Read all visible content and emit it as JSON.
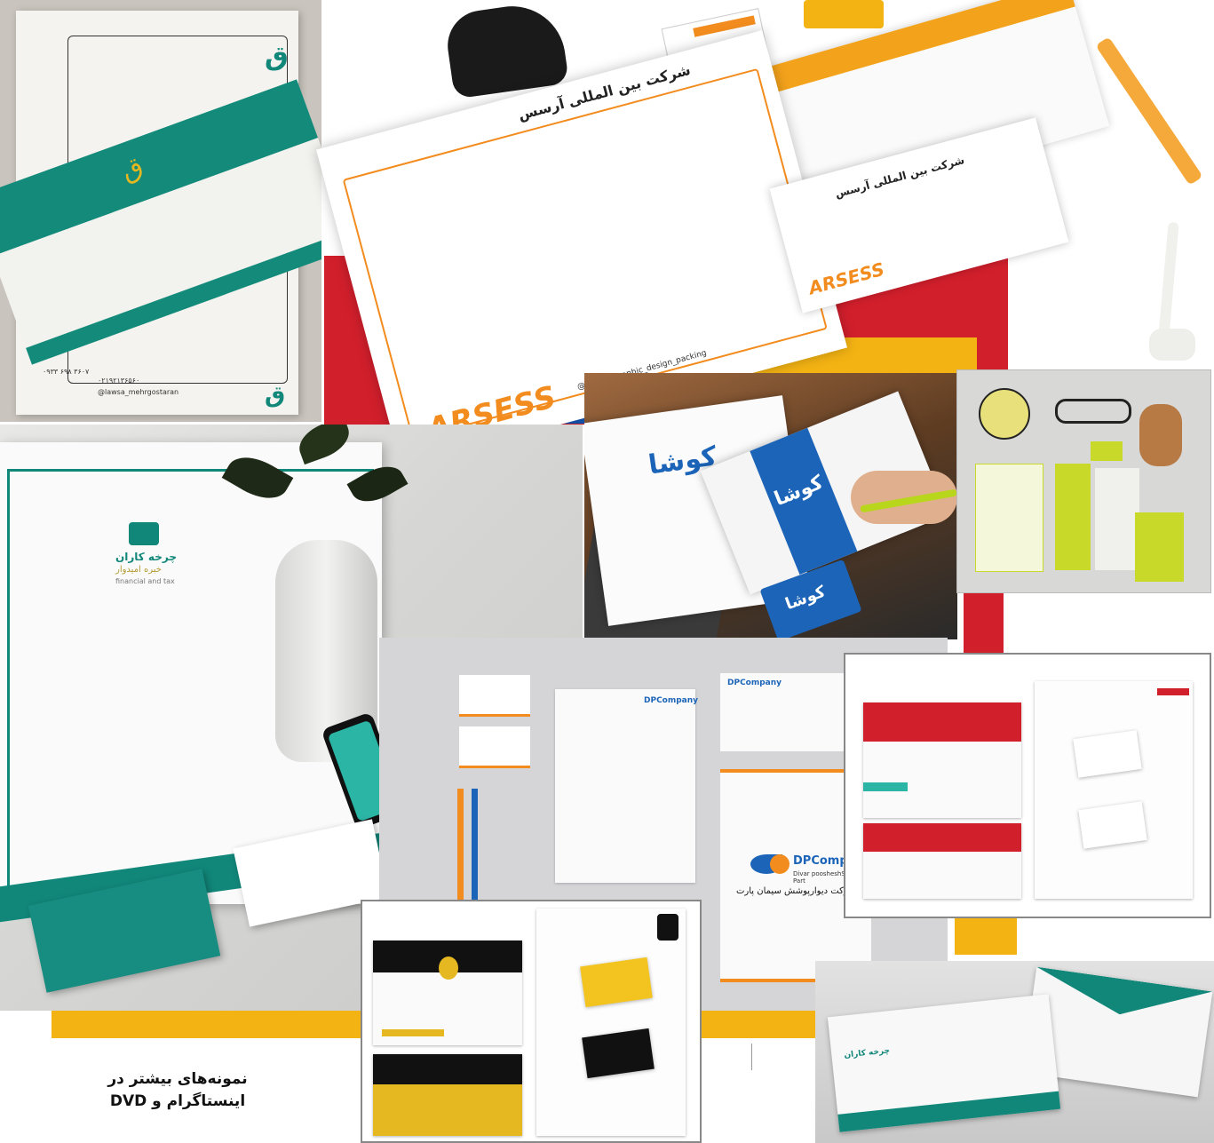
{
  "caption": {
    "line1": "نمونه‌های بیشتر در",
    "line2": "اینستاگرام و DVD"
  },
  "brands": {
    "arsess": "ARSESS",
    "arsess_title": "شرکت بین المللی آرسس",
    "arsess_handle": "@arsess_graphic_design_packing",
    "koosha": "کوشا",
    "dp_company": "DPCompany",
    "dp_sub": "Divar poosheshSiman Part",
    "dp_fa": "شرکت دیوارپوشش سیمان پارت",
    "charkhe": "چرخه کاران",
    "charkhe_fa": "خبره امیدوار",
    "charkhe_en": "financial and tax",
    "mehr_handle": "@lawsa_mehrgostaran",
    "mehr_phone": "۰۹۳۳ ۶۹۸ ۳۶۰۷",
    "mehr_phone2": "۰۲۱۹۲۱۳۶۵۶۰"
  },
  "colors": {
    "red": "#d21f2c",
    "yellow": "#f3b313",
    "blue": "#1457b5",
    "orange": "#f28c1e",
    "teal": "#11877a",
    "koosha_blue": "#1c64b8",
    "gold": "#e5b821"
  }
}
